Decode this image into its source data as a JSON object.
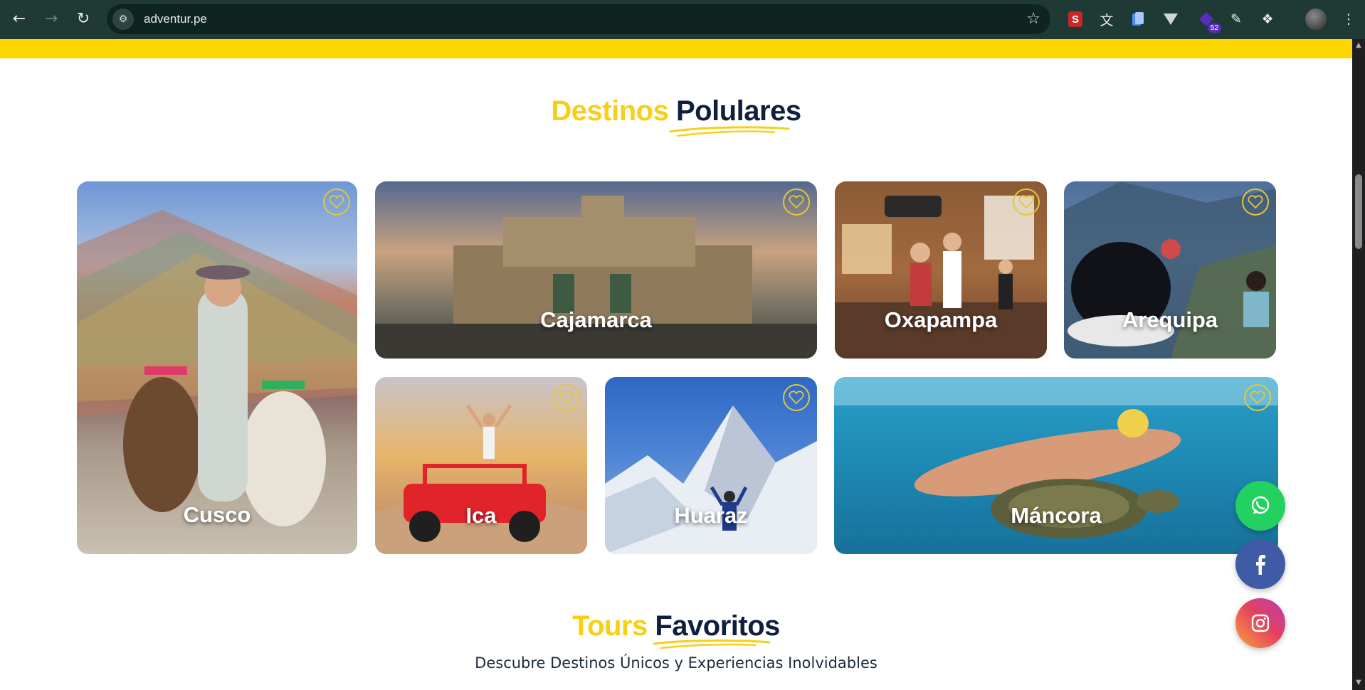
{
  "browser": {
    "url": "adventur.pe",
    "extension_badge_count": "52"
  },
  "colors": {
    "brand_yellow": "#ffd500",
    "title_yellow": "#f7cf16",
    "title_navy": "#101f3d",
    "whatsapp": "#25d366",
    "facebook": "#3b5998"
  },
  "popular": {
    "title_part1": "Destinos",
    "title_part2": "Polulares",
    "destinations": [
      {
        "name": "Cusco",
        "icon": "heart-icon"
      },
      {
        "name": "Cajamarca",
        "icon": "heart-icon"
      },
      {
        "name": "Oxapampa",
        "icon": "heart-icon"
      },
      {
        "name": "Arequipa",
        "icon": "heart-icon"
      },
      {
        "name": "Ica",
        "icon": "heart-icon"
      },
      {
        "name": "Huaraz",
        "icon": "heart-icon"
      },
      {
        "name": "Máncora",
        "icon": "heart-icon"
      }
    ]
  },
  "tours": {
    "title_part1": "Tours",
    "title_part2": "Favoritos",
    "subtitle": "Descubre Destinos Únicos y Experiencias Inolvidables"
  },
  "socials": [
    {
      "name": "whatsapp",
      "icon": "whatsapp-icon"
    },
    {
      "name": "facebook",
      "icon": "facebook-icon"
    },
    {
      "name": "instagram",
      "icon": "instagram-icon"
    }
  ]
}
